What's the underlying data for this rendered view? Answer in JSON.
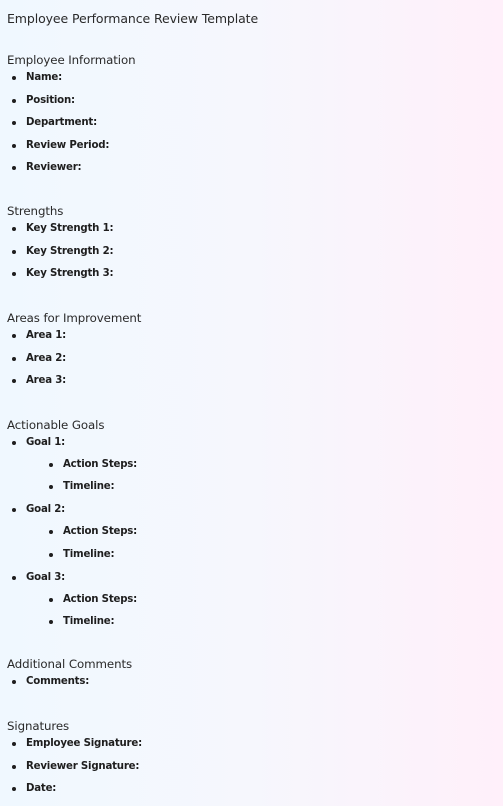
{
  "document": {
    "title": "Employee Performance Review Template",
    "sections": [
      {
        "heading": "Employee Information",
        "items": [
          {
            "label": "Name:"
          },
          {
            "label": "Position:"
          },
          {
            "label": "Department:"
          },
          {
            "label": "Review Period:"
          },
          {
            "label": "Reviewer:"
          }
        ]
      },
      {
        "heading": "Strengths",
        "items": [
          {
            "label": "Key Strength 1:"
          },
          {
            "label": "Key Strength 2:"
          },
          {
            "label": "Key Strength 3:"
          }
        ]
      },
      {
        "heading": "Areas for Improvement",
        "items": [
          {
            "label": "Area 1:"
          },
          {
            "label": "Area 2:"
          },
          {
            "label": "Area 3:"
          }
        ]
      },
      {
        "heading": "Actionable Goals",
        "items": [
          {
            "label": "Goal 1:",
            "sub": [
              {
                "label": "Action Steps:"
              },
              {
                "label": "Timeline:"
              }
            ]
          },
          {
            "label": "Goal 2:",
            "sub": [
              {
                "label": "Action Steps:"
              },
              {
                "label": "Timeline:"
              }
            ]
          },
          {
            "label": "Goal 3:",
            "sub": [
              {
                "label": "Action Steps:"
              },
              {
                "label": "Timeline:"
              }
            ]
          }
        ]
      },
      {
        "heading": "Additional Comments",
        "items": [
          {
            "label": "Comments:"
          }
        ]
      },
      {
        "heading": "Signatures",
        "items": [
          {
            "label": "Employee Signature:"
          },
          {
            "label": "Reviewer Signature:"
          },
          {
            "label": "Date:"
          }
        ]
      }
    ]
  },
  "colors": {
    "background_left": "#f0f8ff",
    "background_right": "#fff0fa",
    "text": "#1e1e1e"
  }
}
